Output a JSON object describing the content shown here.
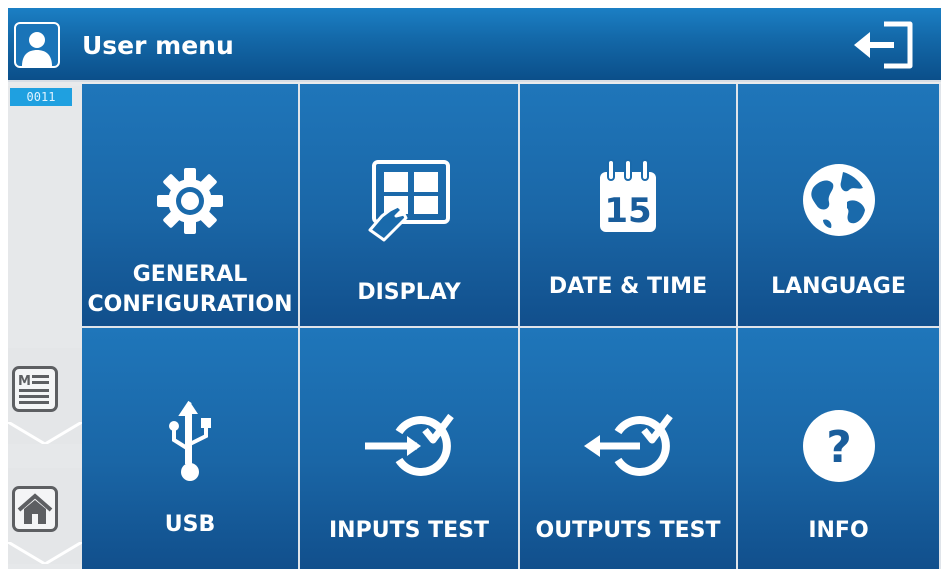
{
  "header": {
    "title": "User menu",
    "user_icon": "user-icon",
    "exit_icon": "exit-icon"
  },
  "status": {
    "counter": "0011"
  },
  "sidebar": {
    "items": [
      {
        "name": "menu",
        "icon": "menu-document-icon"
      },
      {
        "name": "home",
        "icon": "home-icon"
      }
    ]
  },
  "tiles": [
    {
      "label_line1": "GENERAL",
      "label_line2": "CONFIGURATION",
      "icon": "gear-icon"
    },
    {
      "label": "DISPLAY",
      "icon": "display-touch-icon"
    },
    {
      "label": "DATE & TIME",
      "icon": "calendar-icon",
      "calendar_day": "15"
    },
    {
      "label": "LANGUAGE",
      "icon": "globe-icon"
    },
    {
      "label": "USB",
      "icon": "usb-icon"
    },
    {
      "label": "INPUTS TEST",
      "icon": "inputs-test-icon"
    },
    {
      "label": "OUTPUTS TEST",
      "icon": "outputs-test-icon"
    },
    {
      "label": "INFO",
      "icon": "question-icon",
      "glyph": "?"
    }
  ],
  "colors": {
    "header_blue": "#1367a7",
    "tile_blue": "#1a66a6",
    "counter_blue": "#1fa0e0"
  }
}
